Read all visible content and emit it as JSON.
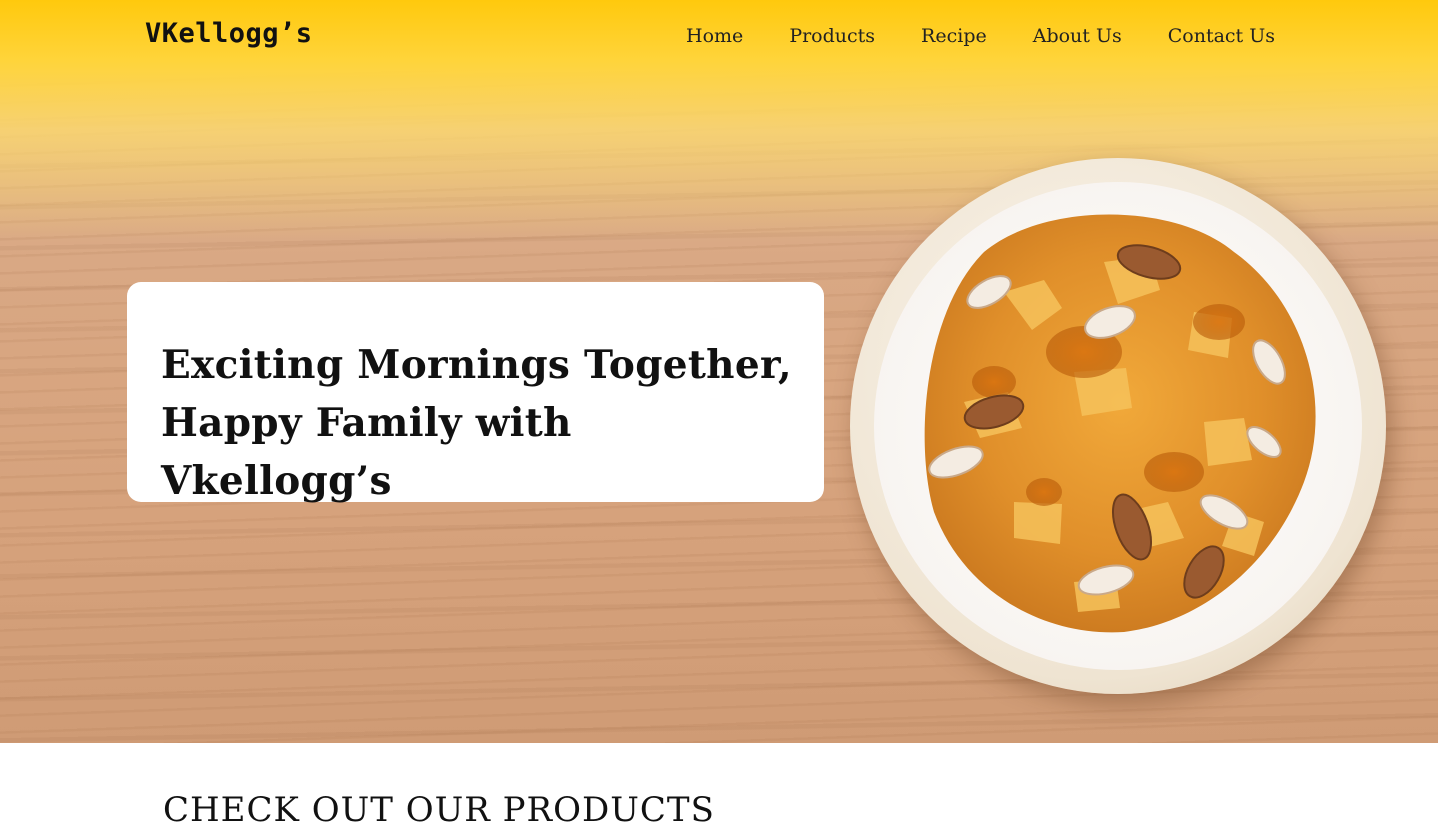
{
  "header": {
    "logo": "VKellogg’s",
    "nav": [
      {
        "label": "Home"
      },
      {
        "label": "Products"
      },
      {
        "label": "Recipe"
      },
      {
        "label": "About Us"
      },
      {
        "label": "Contact Us"
      }
    ]
  },
  "hero": {
    "headline_line1": "Exciting Mornings Together,",
    "headline_line2": "Happy Family with Vkellogg’s",
    "image": "cornflakes-bowl-with-almonds-and-honey"
  },
  "products": {
    "heading": "CHECK OUT OUR PRODUCTS"
  },
  "colors": {
    "header_yellow": "#ffc90d",
    "wood": "#d9a884",
    "card_bg": "#ffffff",
    "text": "#111111"
  }
}
